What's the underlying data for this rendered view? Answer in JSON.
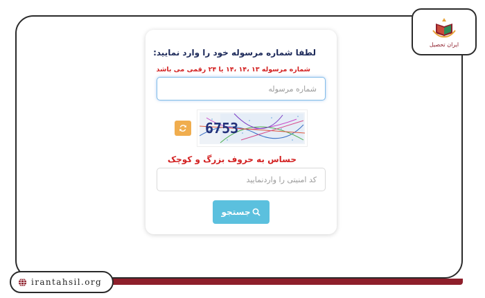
{
  "form": {
    "title": "لطفا شماره مرسوله خود را وارد نمایید:",
    "subtitle": "شماره مرسوله ۱۳ ،۱۴ ،۱۴ یا ۲۴ رقمی می باشد",
    "tracking_input": {
      "placeholder": "شماره مرسوله",
      "value": ""
    },
    "captcha": {
      "text": "6753"
    },
    "refresh_icon": "refresh-icon",
    "case_note": "حساس به حروف بزرگ و کوچک",
    "security_input": {
      "placeholder": "کد امنیتی را واردنمایید",
      "value": ""
    },
    "search_button": {
      "label": "جستجو",
      "icon": "search-icon"
    }
  },
  "branding": {
    "logo_text": "ایران تحصیل",
    "url": "irantahsil.org"
  },
  "colors": {
    "primary_blue": "#5bc0de",
    "refresh_orange": "#f0ad4e",
    "warning_red": "#d32222",
    "title_navy": "#1d2a5a",
    "brand_maroon": "#8e1f2b"
  }
}
